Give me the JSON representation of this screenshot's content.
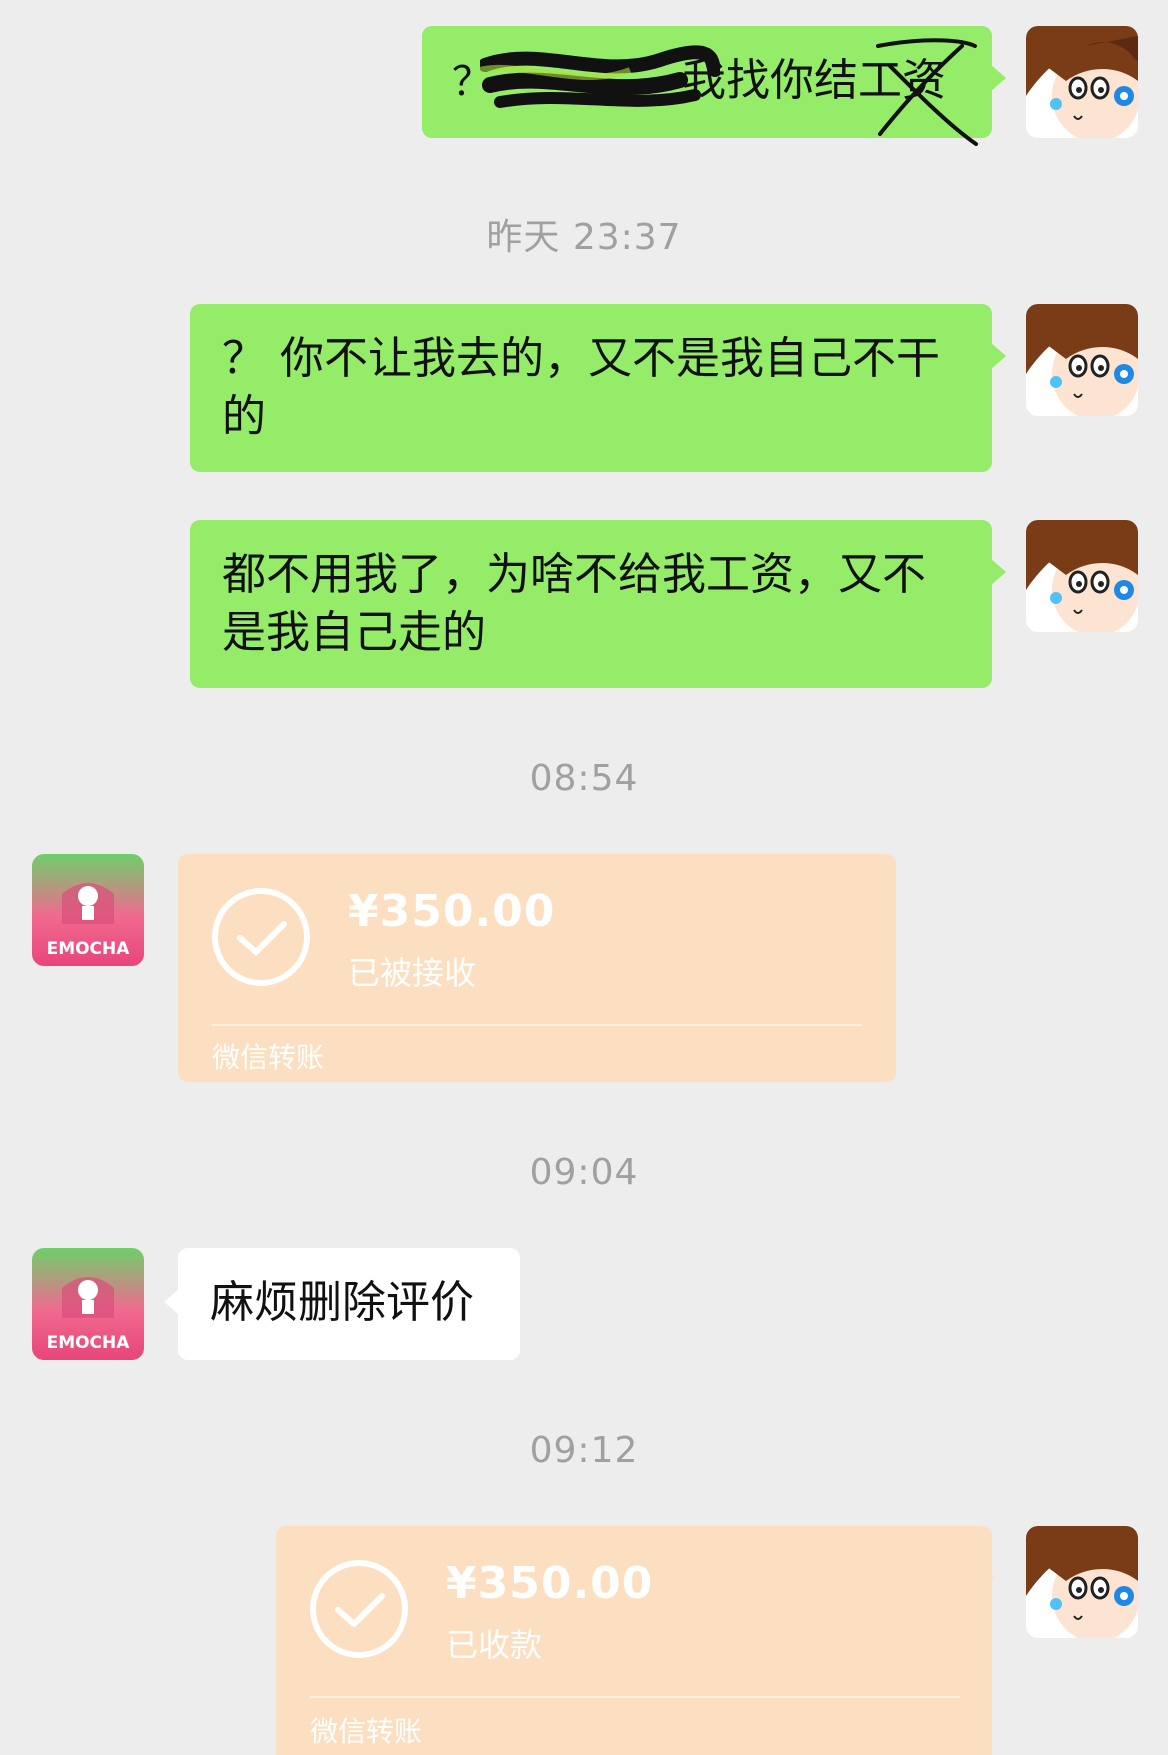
{
  "messages": {
    "m1": {
      "prefix": "？",
      "visible_text": "我找你结工资"
    },
    "t1": "昨天 23:37",
    "m2": "？ 你不让我去的，又不是我自己不干的",
    "m3": "都不用我了，为啥不给我工资，又不是我自己走的",
    "t2": "08:54",
    "transfer1": {
      "amount": "¥350.00",
      "status": "已被接收",
      "brand": "微信转账"
    },
    "t3": "09:04",
    "m4": "麻烦删除评价",
    "t4": "09:12",
    "transfer2": {
      "amount": "¥350.00",
      "status": "已收款",
      "brand": "微信转账"
    }
  },
  "avatars": {
    "self": "cartoon-girl-avatar",
    "other": "emocha-shop-logo",
    "other_logo_text": "EMOCHA"
  },
  "colors": {
    "background": "#ededed",
    "sent_bubble": "#95ec69",
    "received_bubble": "#ffffff",
    "transfer_card": "#fbdfc0",
    "timestamp": "#a0a0a0"
  },
  "icons": {
    "transfer_status": "check-circle-icon",
    "redaction": "scribble-redaction",
    "strike": "cross-out-mark"
  }
}
